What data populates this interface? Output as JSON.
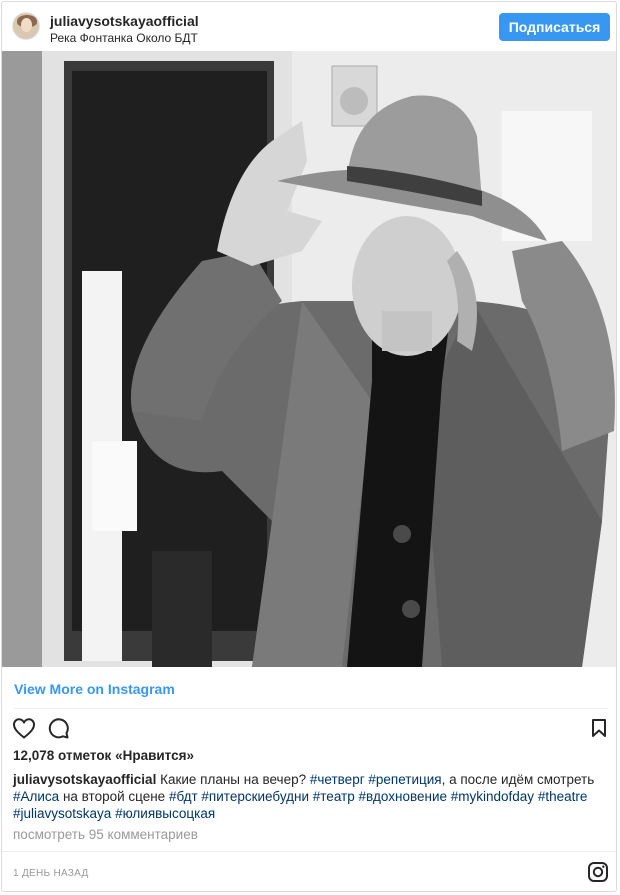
{
  "header": {
    "username": "juliavysotskayaofficial",
    "location": "Река Фонтанка Около БДТ",
    "follow_label": "Подписаться"
  },
  "post": {
    "photo_description_icon": "photo-image",
    "view_more_label": "View More on Instagram",
    "likes_text": "12,078 отметок «Нравится»",
    "caption": {
      "username": "juliavysotskayaofficial",
      "text_1": " Какие планы на вечер? ",
      "tag_1": "#четверг",
      "sp_1": " ",
      "tag_2": "#репетиция",
      "text_2": ", а после идём смотреть ",
      "tag_3": "#Алиса",
      "text_3": " на второй сцене ",
      "tag_4": "#бдт",
      "sp_4": " ",
      "tag_5": "#питерскиебудни",
      "sp_5": " ",
      "tag_6": "#театр",
      "sp_6": " ",
      "tag_7": "#вдохновение",
      "sp_7": " ",
      "tag_8": "#mykindofday",
      "sp_8": " ",
      "tag_9": "#theatre",
      "sp_9": " ",
      "tag_10": "#juliavysotskaya",
      "sp_10": " ",
      "tag_11": "#юлиявысоцкая"
    },
    "comments_link": "посмотреть 95 комментариев",
    "date": "1 ДЕНЬ НАЗАД"
  },
  "icons": {
    "like": "heart-icon",
    "comment": "comment-icon",
    "save": "bookmark-icon",
    "brand": "instagram-icon"
  },
  "colors": {
    "accent": "#3897f0",
    "hashtag": "#003569",
    "muted": "#999999",
    "text": "#262626",
    "border": "#dbdbdb"
  }
}
